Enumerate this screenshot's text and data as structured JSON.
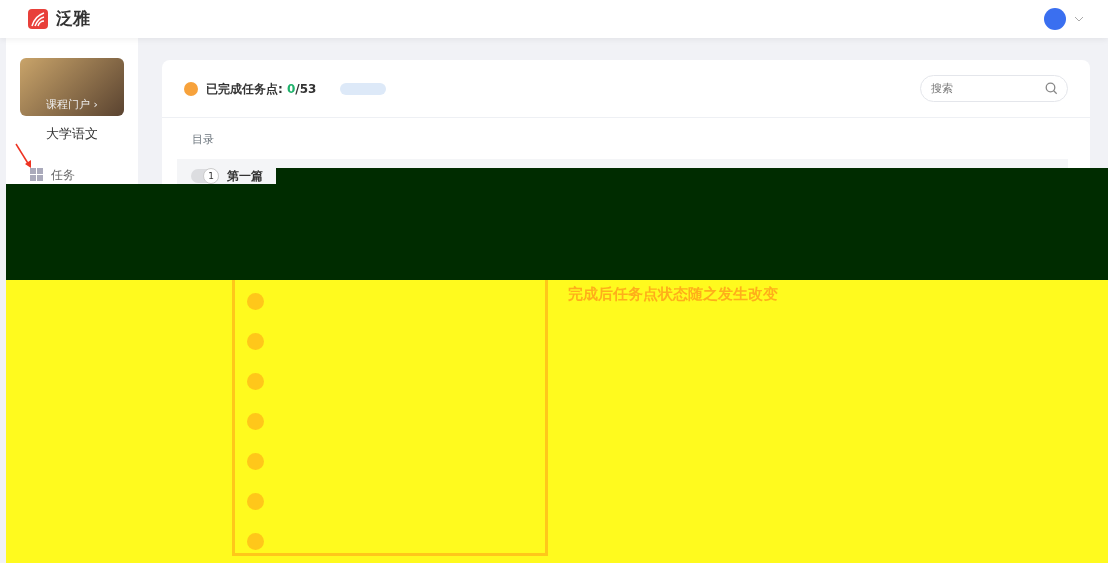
{
  "header": {
    "logo_text": "泛雅"
  },
  "sidebar": {
    "cover_link": "课程门户 ›",
    "course_name": "大学语文",
    "items": [
      {
        "label": "任务",
        "selected": false
      }
    ]
  },
  "progress": {
    "label": "已完成任务点:",
    "done": "0",
    "rest": "/53"
  },
  "search": {
    "placeholder": "搜索"
  },
  "catalog": {
    "heading": "目录",
    "chapters": [
      {
        "number": "1",
        "title": "第一篇"
      }
    ]
  },
  "annotation": "完成后任务点状态随之发生改变"
}
